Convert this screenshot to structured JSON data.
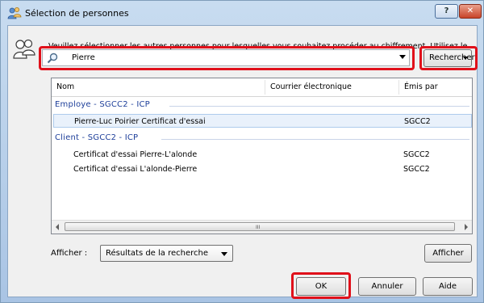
{
  "window": {
    "title": "Sélection de personnes",
    "help_label": "?",
    "close_label": "✕"
  },
  "instructions": "Veuillez sélectionner les autres personnes pour lesquelles vous souhaitez procéder au chiffrement.  Utilisez le bouton de Recherche pour rechercher leurs certificats de chiffrement dans l'annuaire.",
  "search": {
    "value": "Pierre",
    "button_label": "Rechercher"
  },
  "table": {
    "columns": [
      "Nom",
      "Courrier électronique",
      "Émis par"
    ],
    "groups": [
      {
        "label": "Employe - SGCC2 - ICP",
        "rows": [
          {
            "name": "Pierre-Luc Poirier Certificat d'essai",
            "email": "",
            "issuer": "SGCC2"
          }
        ]
      },
      {
        "label": "Client - SGCC2 - ICP",
        "rows": [
          {
            "name": "Certificat d'essai Pierre-L'alonde",
            "email": "",
            "issuer": "SGCC2"
          },
          {
            "name": "Certificat d'essai L'alonde-Pierre",
            "email": "",
            "issuer": "SGCC2"
          }
        ]
      }
    ],
    "scroll_grip": "III"
  },
  "filter": {
    "label": "Afficher :",
    "selected": "Résultats de la recherche",
    "button_label": "Afficher"
  },
  "footer": {
    "ok_label": "OK",
    "cancel_label": "Annuler",
    "help_label": "Aide"
  },
  "colors": {
    "highlight": "#e0101a",
    "group_text": "#1e3f9a"
  }
}
